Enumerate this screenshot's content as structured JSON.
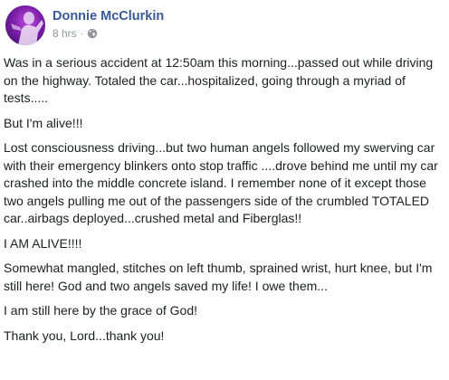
{
  "post": {
    "author": "Donnie McClurkin",
    "timestamp": "8 hrs",
    "separator": "·",
    "audience_icon": "globe-icon",
    "avatar_icon": "profile-avatar",
    "paragraphs": [
      "Was in a serious accident at 12:50am this morning...passed out while driving on the highway. Totaled the car...hospitalized, going through a myriad of tests.....",
      "But I'm alive!!!",
      "Lost consciousness driving...but two human angels followed my swerving car with their emergency blinkers onto stop traffic ....drove behind me until my car crashed into the middle concrete island. I remember none of it except those two angels pulling me out of the passengers side of the crumbled TOTALED car..airbags deployed...crushed metal and Fiberglas!!",
      "I AM ALIVE!!!!",
      "Somewhat mangled, stitches on left thumb, sprained wrist, hurt knee, but I'm still here! God and two angels saved my life! I owe them...",
      "I am still here by the grace of God!",
      "Thank you, Lord...thank you!"
    ]
  },
  "colors": {
    "author_name": "#385898",
    "meta_text": "#90949c",
    "body_text": "#1c1e21",
    "avatar_bg": "#7a1fa8"
  }
}
